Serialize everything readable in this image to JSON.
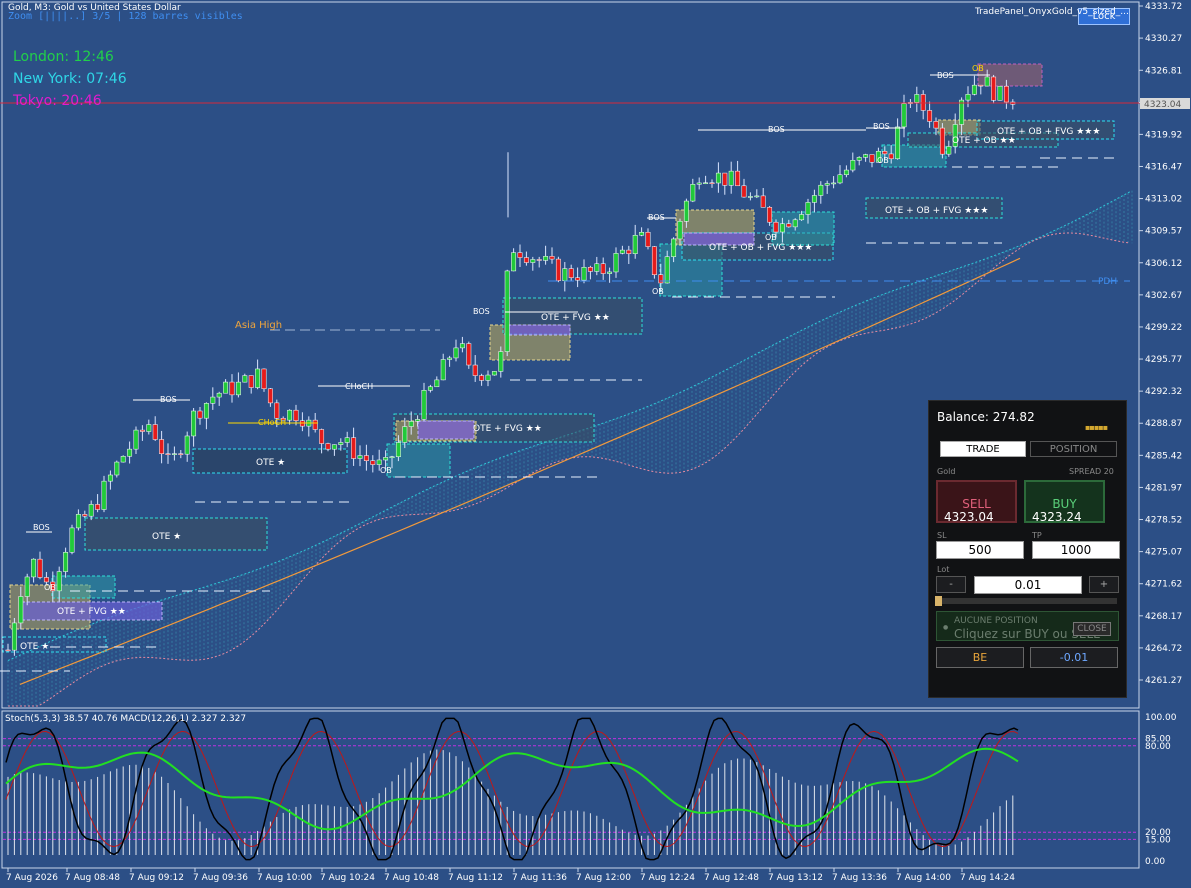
{
  "header": {
    "symbol_title": "Gold, M3:  Gold vs United States Dollar",
    "zoom_text": "Zoom [||||..] 3/5  |  128 barres visibles"
  },
  "sessions": [
    {
      "label": "London:  12:46",
      "color": "#21d04a"
    },
    {
      "label": "New York:  07:46",
      "color": "#2fd6e6"
    },
    {
      "label": "Tokyo:  20:46",
      "color": "#e01ccf"
    }
  ],
  "trade_panel_title": "TradePanel_OnyxGold_v5_sized_...",
  "lock_label": "Lock",
  "price_axis": {
    "ticks": [
      "4333.72",
      "4330.27",
      "4326.81",
      "4323.35",
      "4319.92",
      "4316.47",
      "4313.02",
      "4309.57",
      "4306.12",
      "4302.67",
      "4299.22",
      "4295.77",
      "4292.32",
      "4288.87",
      "4285.42",
      "4281.97",
      "4278.52",
      "4275.07",
      "4271.62",
      "4268.17",
      "4264.72",
      "4261.27"
    ],
    "current_price": "4323.04"
  },
  "time_axis": [
    "7 Aug 2026",
    "7 Aug 08:48",
    "7 Aug 09:12",
    "7 Aug 09:36",
    "7 Aug 10:00",
    "7 Aug 10:24",
    "7 Aug 10:48",
    "7 Aug 11:12",
    "7 Aug 11:36",
    "7 Aug 12:00",
    "7 Aug 12:24",
    "7 Aug 12:48",
    "7 Aug 13:12",
    "7 Aug 13:36",
    "7 Aug 14:00",
    "7 Aug 14:24"
  ],
  "chart_labels": {
    "asia_high": "Asia High",
    "pdh": "PDH",
    "bos": "BOS",
    "choch": "CHoCH",
    "ob": "OB",
    "zones": [
      "OTE ★",
      "OTE + FVG ★★",
      "OTE ★",
      "OTE ★",
      "OTE + FVG ★★",
      "OTE + FVG ★★",
      "OTE + OB + FVG ★★★",
      "OTE + OB + FVG ★★★",
      "OTE + OB + FVG ★★★",
      "OTE + OB ★★"
    ]
  },
  "indicator": {
    "header": "Stoch(5,3,3) 38.57 40.76 MACD(12,26,1) 2.327 2.327",
    "levels": [
      "100.00",
      "85.00",
      "80.00",
      "20.00",
      "15.00",
      "0.00"
    ]
  },
  "panel": {
    "balance": "Balance: 274.82",
    "dots": "▪▪▪▪▪",
    "tab_trade": "TRADE",
    "tab_position": "POSITION",
    "symbol": "Gold",
    "spread": "SPREAD 20",
    "sell_label": "SELL",
    "sell_price": "4323.04",
    "buy_label": "BUY",
    "buy_price": "4323.24",
    "sl_label": "SL",
    "sl_value": "500",
    "tp_label": "TP",
    "tp_value": "1000",
    "lot_label": "Lot",
    "lot_minus": "-",
    "lot_value": "0.01",
    "lot_plus": "+",
    "no_position_title": "AUCUNE POSITION",
    "no_position_hint": "Cliquez sur BUY ou SELL",
    "close_label": "CLOSE",
    "be_label": "BE",
    "pnl_value": "-0.01"
  },
  "colors": {
    "background": "#2c4f86",
    "bull": "#21c93a",
    "bear": "#e51b1b",
    "current_price_line": "#d6293b"
  }
}
